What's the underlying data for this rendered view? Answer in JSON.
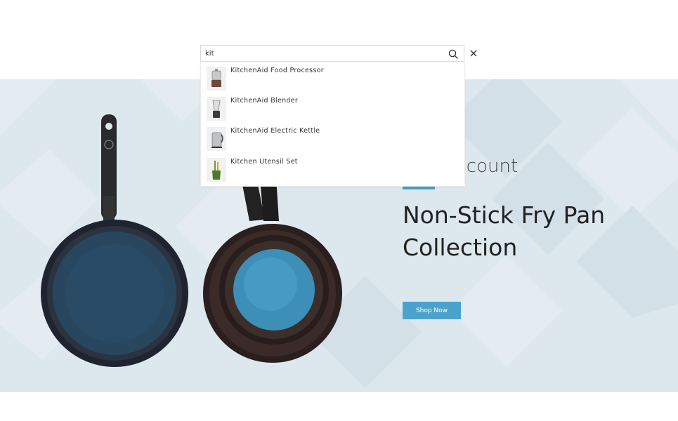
{
  "search": {
    "query": "kit",
    "results": [
      {
        "label": "KitchenAid Food Processor",
        "icon": "food-processor-icon"
      },
      {
        "label": "KitchenAid Blender",
        "icon": "blender-icon"
      },
      {
        "label": "KitchenAid Electric Kettle",
        "icon": "kettle-icon"
      },
      {
        "label": "Kitchen Utensil Set",
        "icon": "utensil-set-icon"
      }
    ]
  },
  "hero": {
    "promo_label": "iscount",
    "title": "Non-Stick Fry Pan Collection",
    "button_label": "Shop Now",
    "colors": {
      "accent": "#4ba3cd",
      "background": "#dde7ee",
      "pan_surface": "#2e5f86"
    }
  }
}
